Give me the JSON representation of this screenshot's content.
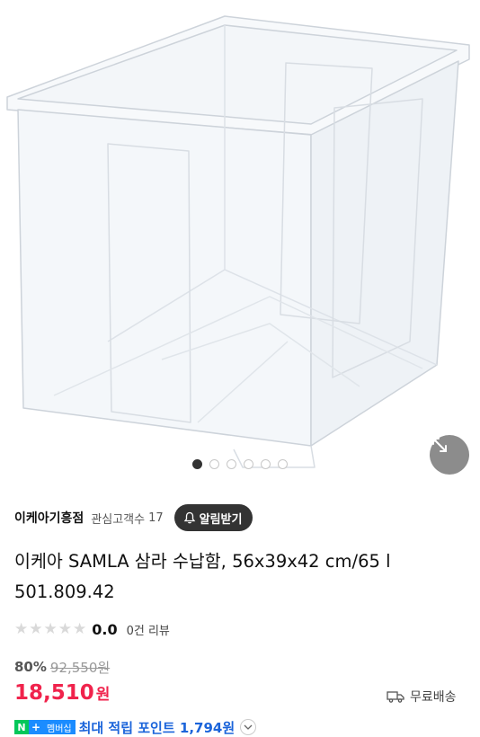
{
  "gallery": {
    "image_alt": "IKEA SAMLA transparent storage box",
    "dot_count": 6,
    "active_index": 0
  },
  "store": {
    "name": "이케아기흥점",
    "followers_label": "관심고객수",
    "followers_count": "17",
    "alarm_label": "알림받기"
  },
  "product": {
    "title": "이케아 SAMLA 삼라 수납함, 56x39x42 cm/65 l 501.809.42"
  },
  "rating": {
    "stars": 0,
    "score": "0.0",
    "reviews": "0건 리뷰"
  },
  "pricing": {
    "discount": "80%",
    "original": "92,550원",
    "price": "18,510",
    "currency": "원",
    "shipping": "무료배송"
  },
  "points": {
    "n_badge": "N",
    "plus_badge": "+",
    "membership": "멤버십",
    "text": "최대 적립 포인트 1,794원"
  },
  "colors": {
    "price_red": "#f0234c",
    "points_blue": "#1b64da",
    "naver_green": "#03c75a"
  }
}
